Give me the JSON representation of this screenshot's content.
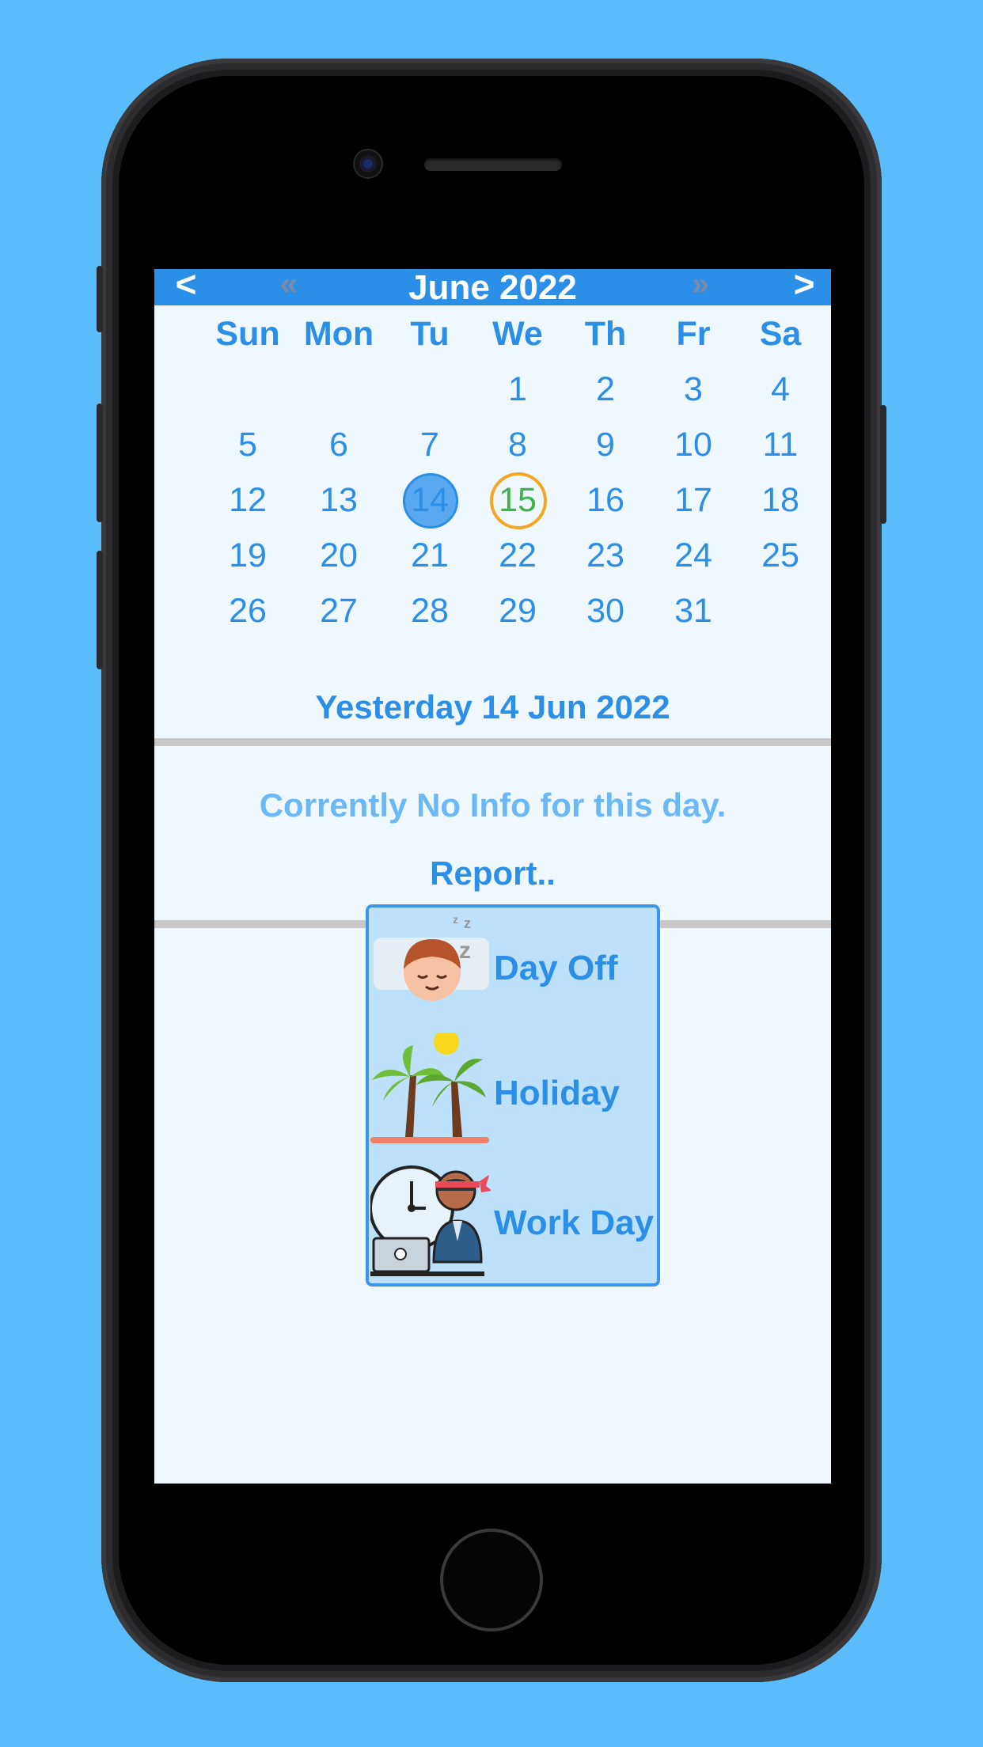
{
  "calendar": {
    "month_title": "June 2022",
    "nav": {
      "prev_month": "<",
      "prev_year": "«",
      "next_year": "»",
      "next_month": ">"
    },
    "weekdays": [
      "Sun",
      "Mon",
      "Tu",
      "We",
      "Th",
      "Fr",
      "Sa"
    ],
    "weeks": [
      [
        "",
        "",
        "",
        "1",
        "2",
        "3",
        "4"
      ],
      [
        "5",
        "6",
        "7",
        "8",
        "9",
        "10",
        "11"
      ],
      [
        "12",
        "13",
        "14",
        "15",
        "16",
        "17",
        "18"
      ],
      [
        "19",
        "20",
        "21",
        "22",
        "23",
        "24",
        "25"
      ],
      [
        "26",
        "27",
        "28",
        "29",
        "30",
        "31",
        ""
      ]
    ],
    "selected_day": "14",
    "today_day": "15"
  },
  "day_info": {
    "date_label": "Yesterday 14 Jun 2022",
    "no_info_text": "Corrently No Info for this day.",
    "report_label": "Report.."
  },
  "report_menu": {
    "items": [
      {
        "label": "Day Off",
        "icon": "sleeping-face-icon"
      },
      {
        "label": "Holiday",
        "icon": "palm-trees-icon"
      },
      {
        "label": "Work Day",
        "icon": "worker-clock-laptop-icon"
      }
    ]
  },
  "colors": {
    "background": "#5bbcfc",
    "accent": "#2b8fe8",
    "today_ring": "#f5a623",
    "today_text": "#3cb44b",
    "menu_bg": "#bde0fb"
  }
}
